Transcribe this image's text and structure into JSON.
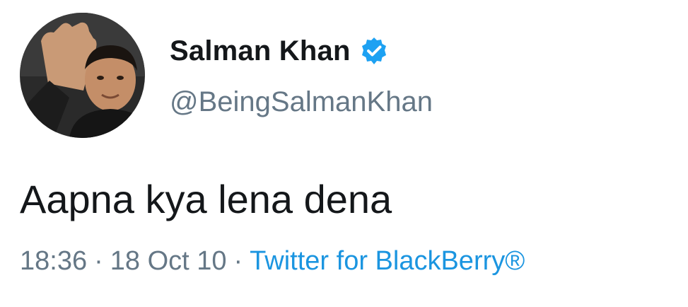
{
  "tweet": {
    "author": {
      "display_name": "Salman Khan",
      "handle": "@BeingSalmanKhan",
      "verified": true,
      "avatar_icon": "profile-photo"
    },
    "text": "Aapna kya lena dena",
    "meta": {
      "time": "18:36",
      "separator": "·",
      "date": "18 Oct 10",
      "source": "Twitter for BlackBerry®"
    }
  },
  "colors": {
    "text_primary": "#14171a",
    "text_secondary": "#657786",
    "link": "#1b95e0",
    "verified_badge": "#1da1f2"
  }
}
